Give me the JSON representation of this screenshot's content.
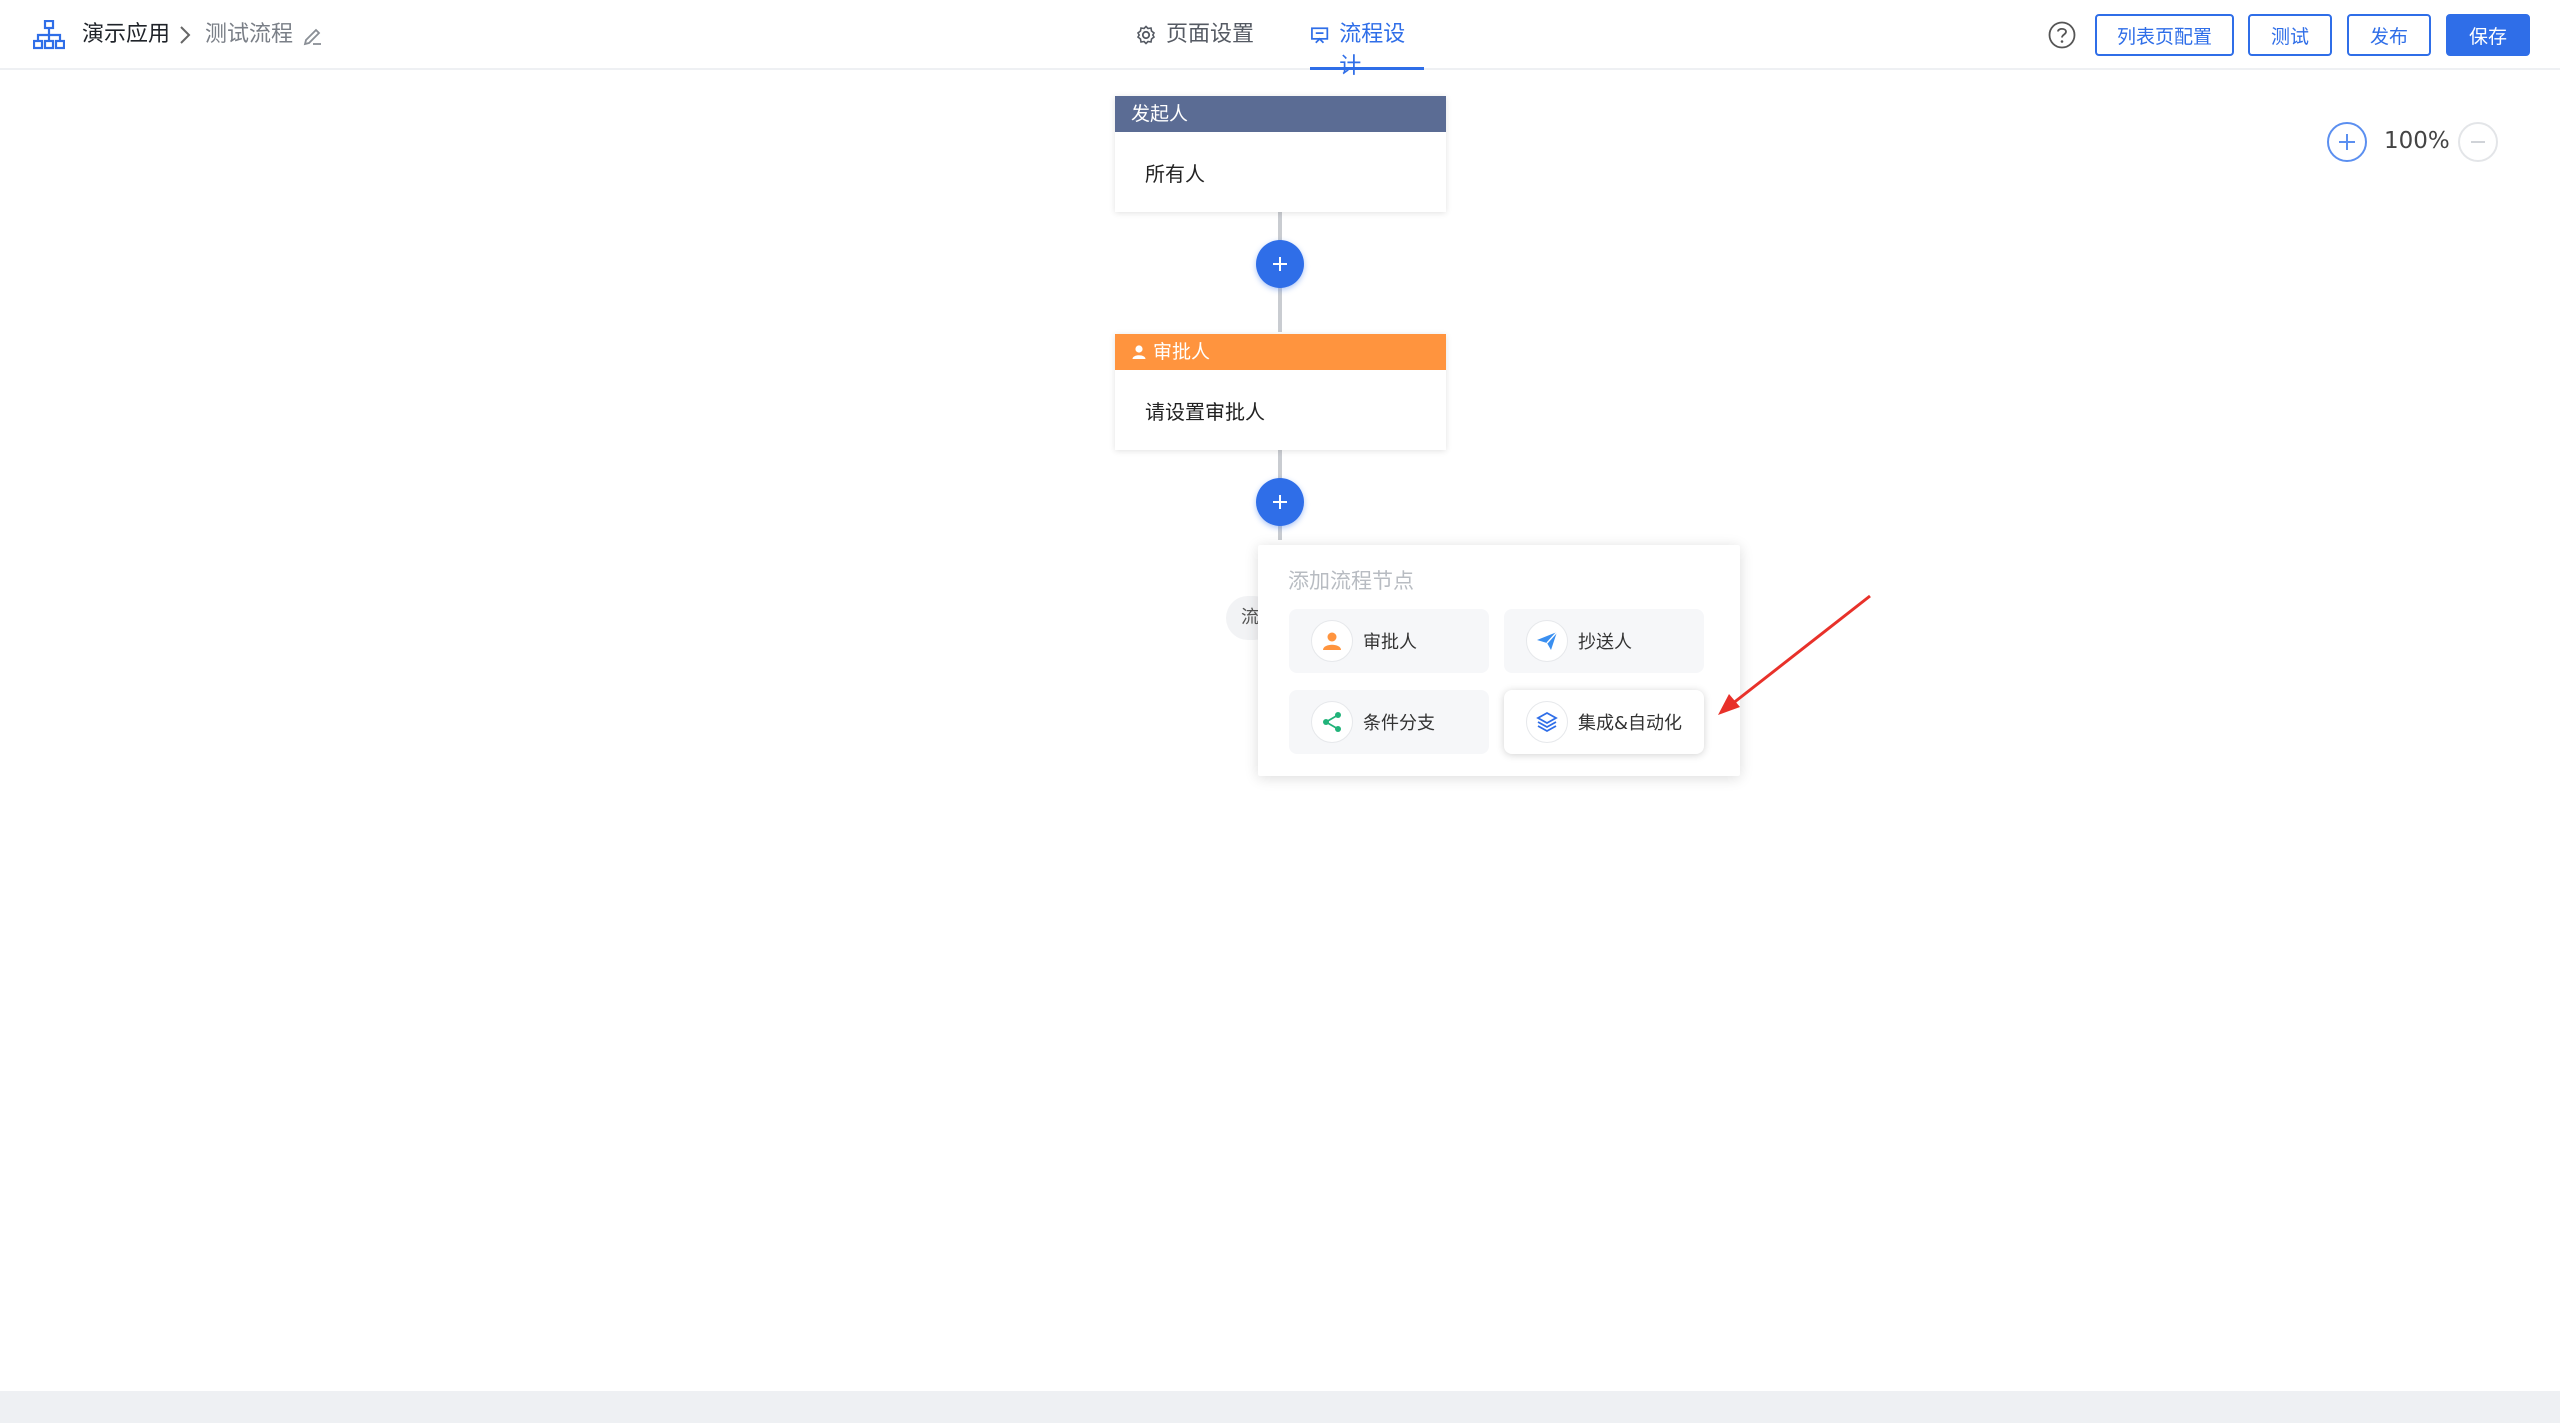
{
  "header": {
    "app_name": "演示应用",
    "flow_name": "测试流程",
    "tabs": [
      {
        "label": "页面设置",
        "active": false
      },
      {
        "label": "流程设计",
        "active": true
      }
    ],
    "buttons": {
      "list_config": "列表页配置",
      "test": "测试",
      "publish": "发布",
      "save": "保存"
    }
  },
  "zoom": {
    "level": "100%"
  },
  "nodes": {
    "start": {
      "title": "发起人",
      "content": "所有人"
    },
    "approver": {
      "title": "审批人",
      "content": "请设置审批人"
    }
  },
  "hidden_chip": {
    "text": "流"
  },
  "popup": {
    "title": "添加流程节点",
    "options": [
      {
        "label": "审批人",
        "icon": "user-icon",
        "color": "#ff943e"
      },
      {
        "label": "抄送人",
        "icon": "send-icon",
        "color": "#3a8ff0"
      },
      {
        "label": "条件分支",
        "icon": "branch-icon",
        "color": "#21b37a"
      },
      {
        "label": "集成&自动化",
        "icon": "layers-icon",
        "color": "#2f6ee8"
      }
    ]
  },
  "colors": {
    "accent": "#2f6ee8",
    "start_header": "#5b6c94",
    "approver_header": "#ff943e",
    "annotation_arrow": "#e8312a"
  }
}
